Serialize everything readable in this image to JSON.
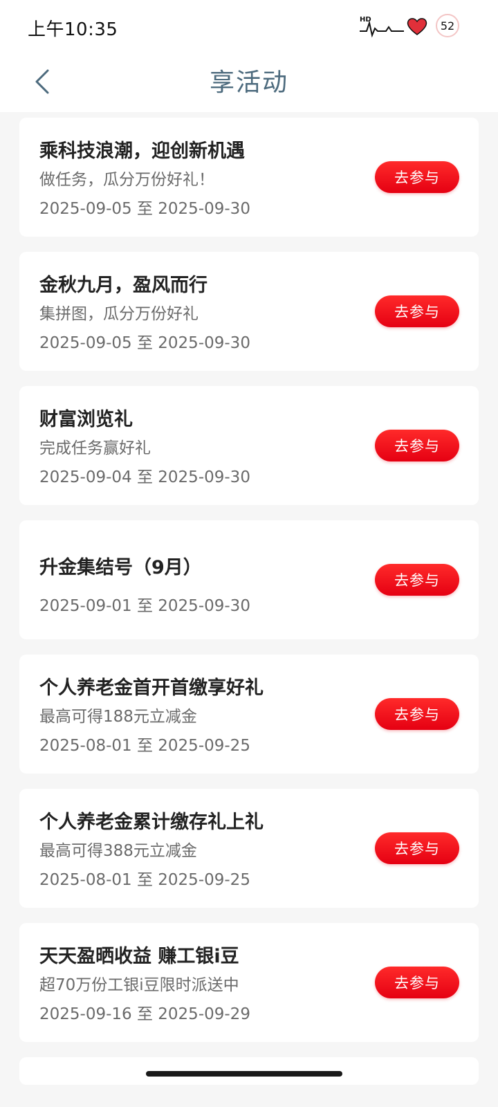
{
  "status_bar": {
    "time": "上午10:35",
    "hd_label": "HD",
    "battery_level": "52",
    "icons": [
      "hd-heartbeat-icon",
      "heart-icon",
      "battery-icon"
    ]
  },
  "header": {
    "title": "享活动",
    "back_icon": "chevron-left-icon"
  },
  "colors": {
    "accent": "#e50012",
    "title": "#4c6a7d"
  },
  "activities": [
    {
      "title": "乘科技浪潮，迎创新机遇",
      "subtitle": "做任务，瓜分万份好礼！",
      "date": "2025-09-05 至 2025-09-30",
      "button": "去参与"
    },
    {
      "title": "金秋九月，盈风而行",
      "subtitle": "集拼图，瓜分万份好礼",
      "date": "2025-09-05 至 2025-09-30",
      "button": "去参与"
    },
    {
      "title": "财富浏览礼",
      "subtitle": "完成任务赢好礼",
      "date": "2025-09-04 至 2025-09-30",
      "button": "去参与"
    },
    {
      "title": "升金集结号（9月）",
      "subtitle": "",
      "date": "2025-09-01 至 2025-09-30",
      "button": "去参与"
    },
    {
      "title": "个人养老金首开首缴享好礼",
      "subtitle": "最高可得188元立减金",
      "date": "2025-08-01 至 2025-09-25",
      "button": "去参与"
    },
    {
      "title": "个人养老金累计缴存礼上礼",
      "subtitle": "最高可得388元立减金",
      "date": "2025-08-01 至 2025-09-25",
      "button": "去参与"
    },
    {
      "title": "天天盈晒收益 赚工银i豆",
      "subtitle": "超70万份工银i豆限时派送中",
      "date": "2025-09-16 至 2025-09-29",
      "button": "去参与"
    }
  ]
}
